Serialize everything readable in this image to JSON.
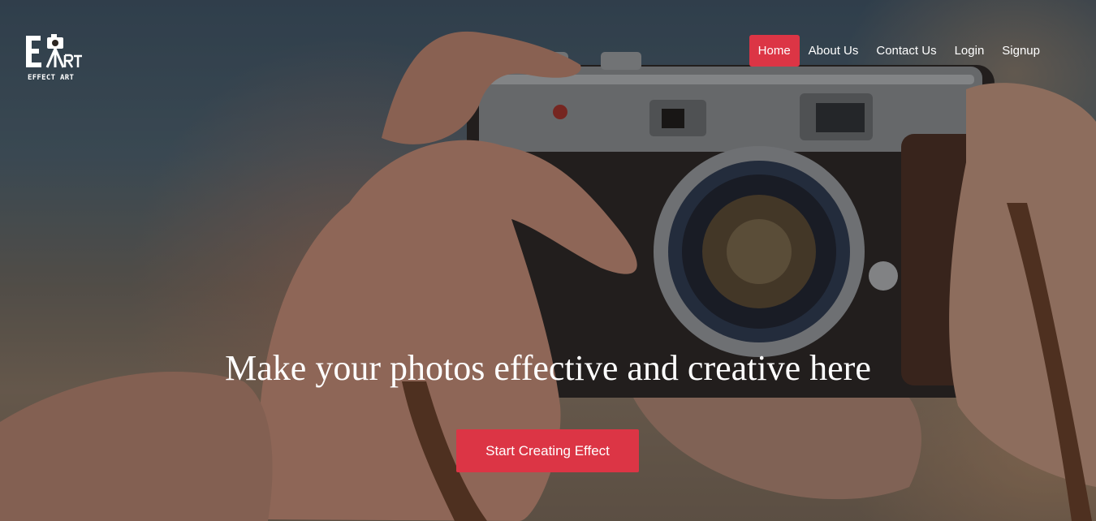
{
  "brand": {
    "logo_mark": "EART",
    "logo_text": "EFFECT ART"
  },
  "nav": {
    "items": [
      {
        "label": "Home",
        "active": true
      },
      {
        "label": "About Us",
        "active": false
      },
      {
        "label": "Contact Us",
        "active": false
      },
      {
        "label": "Login",
        "active": false
      },
      {
        "label": "Signup",
        "active": false
      }
    ]
  },
  "hero": {
    "headline": "Make your photos effective and creative here",
    "cta_label": "Start Creating Effect"
  },
  "colors": {
    "accent": "#dc3545",
    "text": "#ffffff"
  }
}
